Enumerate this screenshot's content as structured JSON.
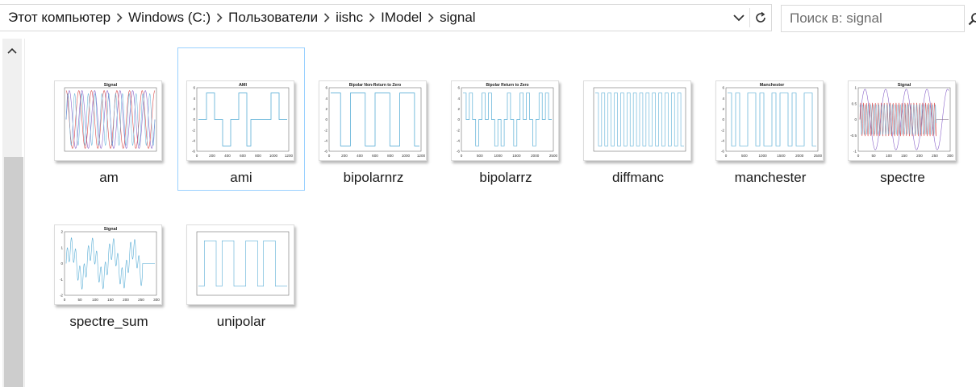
{
  "address_bar": {
    "path": [
      "Этот компьютер",
      "Windows (C:)",
      "Пользователи",
      "iishc",
      "IModel",
      "signal"
    ]
  },
  "search": {
    "placeholder": "Поиск в: signal",
    "value": ""
  },
  "files": [
    {
      "name": "am",
      "thumbnail_title": "Signal",
      "ticks_x": [],
      "ticks_y": []
    },
    {
      "name": "ami",
      "thumbnail_title": "AMI",
      "ticks_x": [
        "0",
        "200",
        "400",
        "600",
        "800",
        "1000",
        "1200"
      ],
      "ticks_y": [
        "6",
        "4",
        "2",
        "0",
        "-2",
        "-4",
        "-6"
      ],
      "selected": true
    },
    {
      "name": "bipolarnrz",
      "thumbnail_title": "Bipolar Non-Return to Zero",
      "ticks_x": [
        "0",
        "200",
        "400",
        "600",
        "800",
        "1000",
        "1200"
      ],
      "ticks_y": [
        "6",
        "4",
        "2",
        "0",
        "-2",
        "-4",
        "-6"
      ]
    },
    {
      "name": "bipolarrz",
      "thumbnail_title": "Bipolar Return to Zero",
      "ticks_x": [
        "0",
        "500",
        "1000",
        "1500",
        "2000",
        "2500"
      ],
      "ticks_y": [
        "6",
        "4",
        "2",
        "0",
        "-2",
        "-4",
        "-6"
      ]
    },
    {
      "name": "diffmanc",
      "thumbnail_title": "",
      "ticks_x": [],
      "ticks_y": []
    },
    {
      "name": "manchester",
      "thumbnail_title": "Manchester",
      "ticks_x": [
        "0",
        "500",
        "1000",
        "1500",
        "2000",
        "2500"
      ],
      "ticks_y": [
        "6",
        "4",
        "2",
        "0",
        "-2",
        "-4",
        "-6"
      ]
    },
    {
      "name": "spectre",
      "thumbnail_title": "Signal",
      "ticks_x": [
        "0",
        "50",
        "100",
        "150",
        "200",
        "250",
        "300"
      ],
      "ticks_y": [
        "1",
        "0.5",
        "0",
        "-0.5",
        "-1"
      ]
    },
    {
      "name": "spectre_sum",
      "thumbnail_title": "Signal",
      "ticks_x": [
        "0",
        "50",
        "100",
        "150",
        "200",
        "250",
        "300"
      ],
      "ticks_y": [
        "2",
        "1",
        "0",
        "-1",
        "-2"
      ]
    },
    {
      "name": "unipolar",
      "thumbnail_title": "",
      "ticks_x": [],
      "ticks_y": []
    }
  ],
  "colors": {
    "selection_border": "#99d1ff",
    "plot_line": "#5aaed6",
    "plot_red": "#d94a4a",
    "plot_purple": "#8a63c9"
  }
}
